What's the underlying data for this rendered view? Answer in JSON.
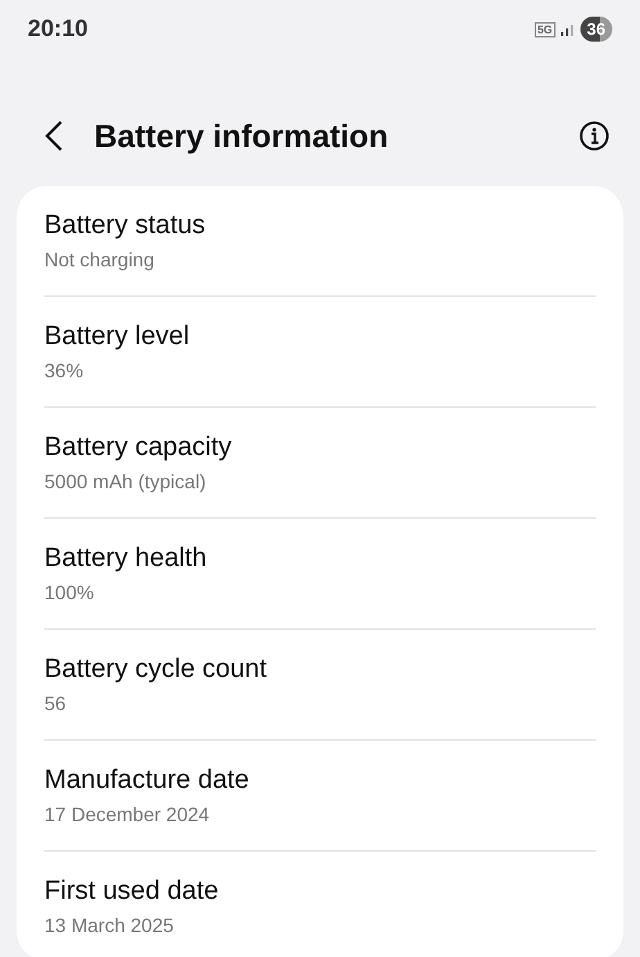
{
  "status_bar": {
    "time": "20:10",
    "network": "5G",
    "battery": "36"
  },
  "header": {
    "title": "Battery information"
  },
  "items": [
    {
      "title": "Battery status",
      "value": "Not charging"
    },
    {
      "title": "Battery level",
      "value": "36%"
    },
    {
      "title": "Battery capacity",
      "value": "5000 mAh (typical)"
    },
    {
      "title": "Battery health",
      "value": "100%"
    },
    {
      "title": "Battery cycle count",
      "value": "56"
    },
    {
      "title": "Manufacture date",
      "value": "17 December 2024"
    },
    {
      "title": "First used date",
      "value": "13 March 2025"
    }
  ]
}
